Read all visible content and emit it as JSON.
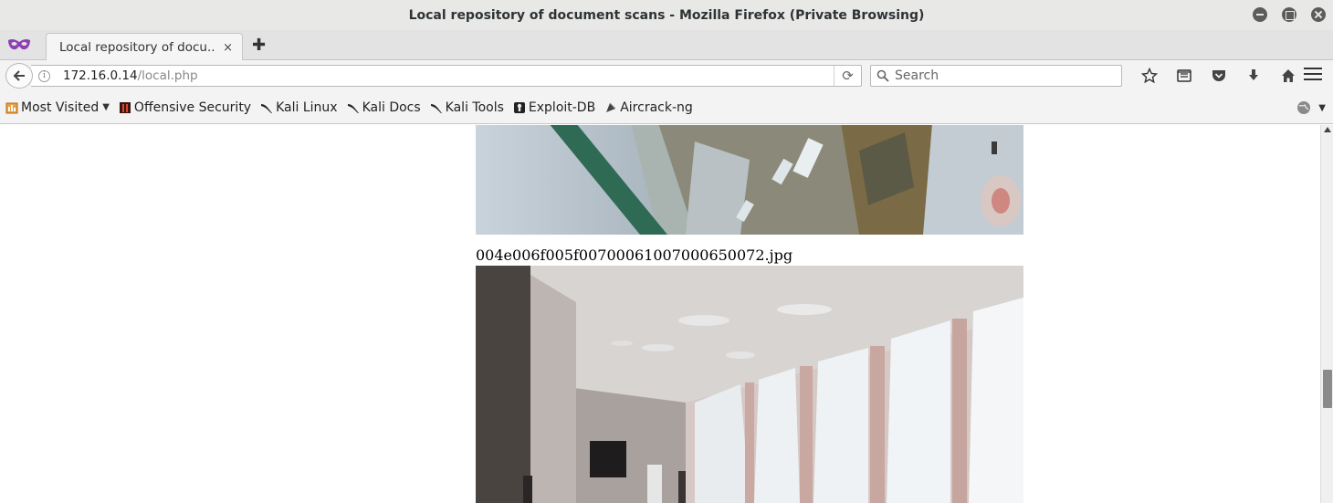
{
  "window": {
    "title": "Local repository of document scans - Mozilla Firefox (Private Browsing)"
  },
  "tabs": [
    {
      "label": "Local repository of docu...",
      "close": "×"
    }
  ],
  "new_tab": "✚",
  "navbar": {
    "url_host": "172.16.0.14",
    "url_path": "/local.php",
    "search_placeholder": "Search",
    "info": "i",
    "reload": "⟳"
  },
  "bookmarks": [
    {
      "label": "Most Visited",
      "icon": "most-visited-icon",
      "arrow": "▼"
    },
    {
      "label": "Offensive Security",
      "icon": "offsec-icon"
    },
    {
      "label": "Kali Linux",
      "icon": "kali-dragon-icon"
    },
    {
      "label": "Kali Docs",
      "icon": "kali-dragon-icon"
    },
    {
      "label": "Kali Tools",
      "icon": "kali-dragon-icon"
    },
    {
      "label": "Exploit-DB",
      "icon": "exploit-db-icon"
    },
    {
      "label": "Aircrack-ng",
      "icon": "aircrack-icon"
    }
  ],
  "bookmarks_extra_arrow": "▼",
  "content": {
    "images": [
      {
        "kind": "aerial snowy ground photograph"
      },
      {
        "kind": "interior corridor photograph",
        "caption": "004e006f005f00700061007000650072.jpg"
      }
    ]
  },
  "colors": {
    "titlebar": "#e8e8e7",
    "toolbar": "#f3f3f3",
    "private_mask": "#8e3fb6"
  }
}
